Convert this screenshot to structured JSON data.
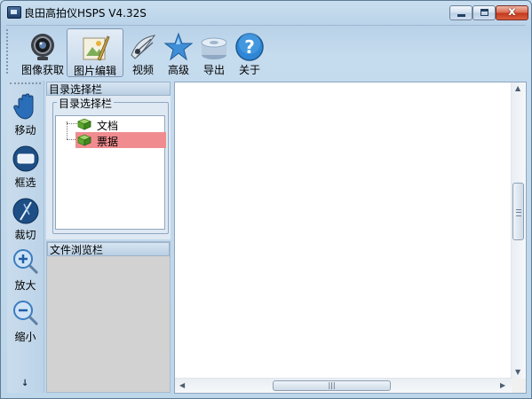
{
  "window": {
    "title": "良田高拍仪HSPS V4.32S"
  },
  "window_controls": {
    "minimize": "",
    "maximize": "",
    "close": "x"
  },
  "toolbar": {
    "items": [
      {
        "label": "图像获取",
        "icon": "camera-icon"
      },
      {
        "label": "图片编辑",
        "icon": "image-edit-icon",
        "active": true
      },
      {
        "label": "视频",
        "icon": "video-icon"
      },
      {
        "label": "高级",
        "icon": "star-icon"
      },
      {
        "label": "导出",
        "icon": "export-disk-icon"
      },
      {
        "label": "关于",
        "icon": "help-icon"
      }
    ]
  },
  "tools": [
    {
      "label": "移动",
      "icon": "hand-icon"
    },
    {
      "label": "框选",
      "icon": "marquee-select-icon"
    },
    {
      "label": "裁切",
      "icon": "crop-icon"
    },
    {
      "label": "放大",
      "icon": "zoom-in-icon"
    },
    {
      "label": "缩小",
      "icon": "zoom-out-icon"
    }
  ],
  "dir_panel": {
    "header": "目录选择栏",
    "group_label": "目录选择栏",
    "tree": [
      {
        "label": "文档",
        "icon": "book-icon",
        "selected": false
      },
      {
        "label": "票据",
        "icon": "book-icon",
        "selected": true
      }
    ]
  },
  "browse_panel": {
    "header": "文件浏览栏"
  },
  "colors": {
    "selected_row": "#f08c8f",
    "chrome": "#c4dcef"
  }
}
